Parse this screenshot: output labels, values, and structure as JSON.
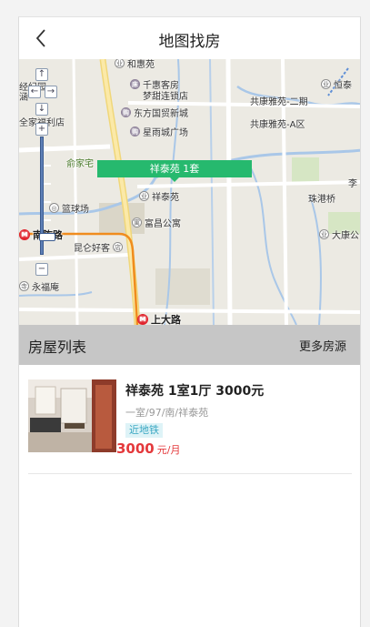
{
  "header": {
    "title": "地图找房"
  },
  "map": {
    "marker": "祥泰苑 1套",
    "pois": {
      "hehuiyuan": "和惠苑",
      "qianhui": "千惠客房",
      "qianhui2": "梦甜连锁店",
      "dongfang": "东方国贸新城",
      "xingyu": "星雨城广场",
      "jingyuan": "经纪园",
      "xian": "涵",
      "quanjia": "全家福利店",
      "yujia": "俞家宅",
      "xiangtai": "祥泰苑",
      "lanqiu": "篮球场",
      "fuchang": "富昌公寓",
      "nanqiao": "南陈路",
      "kunlun": "昆仑好客",
      "yongfu": "永福庵",
      "shangda": "上大路",
      "gongkang2": "共康雅苑-二期",
      "gongkanga": "共康雅苑-A区",
      "hengyuan": "恒泰",
      "zhugang": "珠港桥",
      "dakang": "大康公",
      "li": "李"
    }
  },
  "list": {
    "title": "房屋列表",
    "more": "更多房源"
  },
  "listing": {
    "title": "祥泰苑 1室1厅 3000元",
    "sub": "一室/97/南/祥泰苑",
    "tag": "近地铁",
    "price": "3000",
    "unit": "元/月"
  }
}
